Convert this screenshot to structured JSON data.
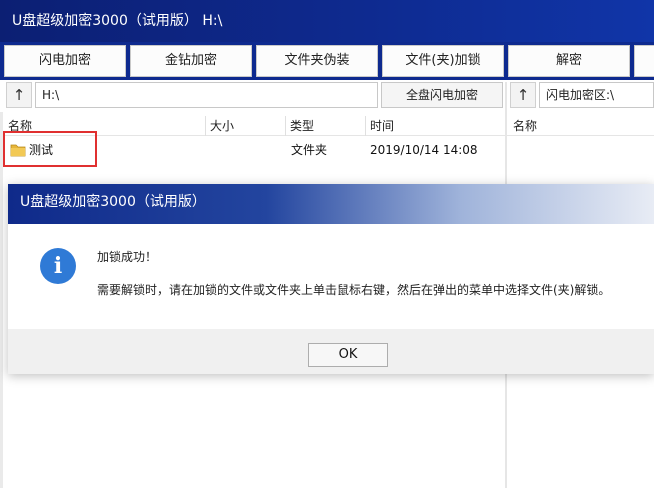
{
  "window": {
    "title": "U盘超级加密3000（试用版） H:\\"
  },
  "toolbar": {
    "buttons": [
      "闪电加密",
      "金钻加密",
      "文件夹伪装",
      "文件(夹)加锁",
      "解密"
    ]
  },
  "left_pane": {
    "up_arrow": "↑",
    "path": "H:\\",
    "full_encrypt_label": "全盘闪电加密",
    "columns": [
      "名称",
      "大小",
      "类型",
      "时间"
    ],
    "rows": [
      {
        "name": "测试",
        "size": "",
        "type": "文件夹",
        "time": "2019/10/14 14:08"
      }
    ]
  },
  "right_pane": {
    "up_arrow": "↑",
    "path": "闪电加密区:\\",
    "columns": [
      "名称"
    ]
  },
  "dialog": {
    "title": "U盘超级加密3000（试用版）",
    "icon": "info-icon",
    "icon_glyph": "i",
    "heading": "加锁成功！",
    "message": "需要解锁时，请在加锁的文件或文件夹上单击鼠标右键，然后在弹出的菜单中选择文件(夹)解锁。",
    "ok_label": "OK"
  },
  "colors": {
    "titlebar": "#0e2a8f",
    "info_icon": "#2f7ad6",
    "highlight_box": "#e03030",
    "folder_icon": "#e6b53a"
  }
}
